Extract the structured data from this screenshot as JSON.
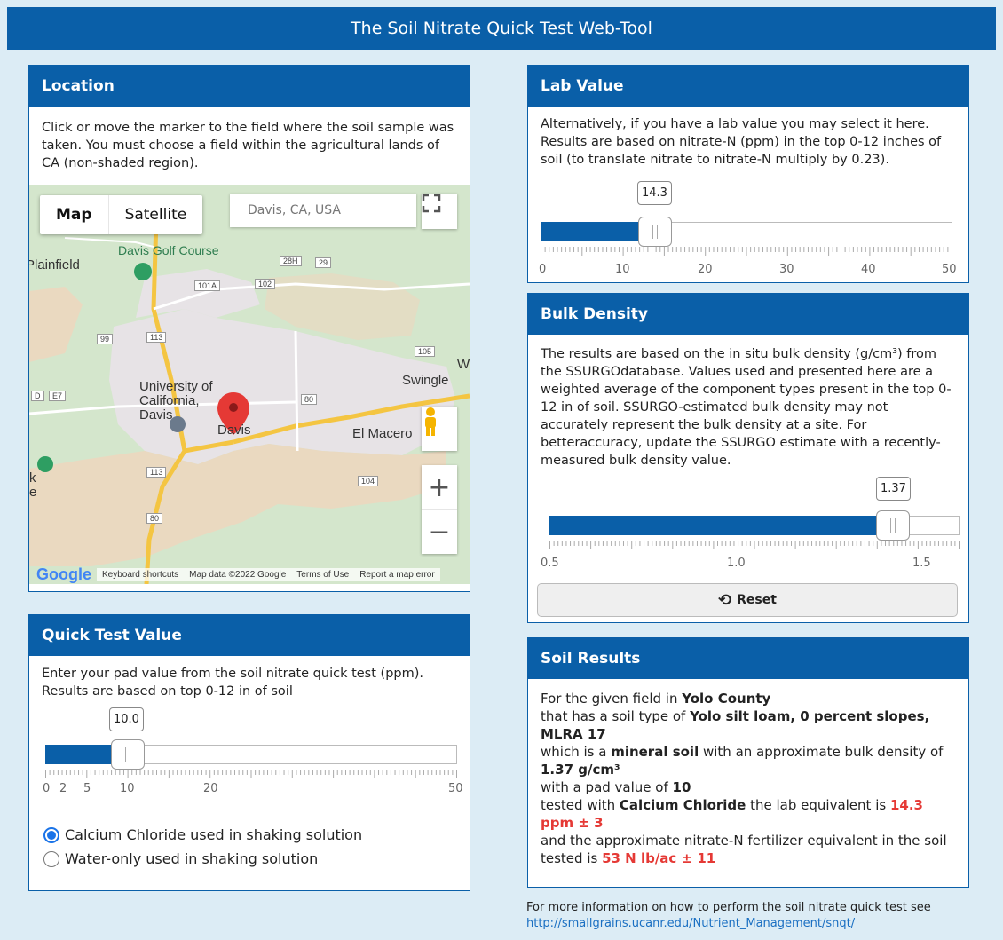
{
  "header": {
    "title": "The Soil Nitrate Quick Test Web-Tool"
  },
  "location": {
    "title": "Location",
    "description": "Click or move the marker to the field where the soil sample was taken. You must choose a field within the agricultural lands of CA (non-shaded region).",
    "map": {
      "toggle": [
        "Map",
        "Satellite"
      ],
      "search_placeholder": "Davis, CA, USA",
      "labels": {
        "golf": "Davis Golf Course",
        "plainfield": "Plainfield",
        "university": "University of\nCalifornia,\nDavis",
        "davis": "Davis",
        "el_macero": "El Macero",
        "swingle": "Swingle",
        "w": "W",
        "k": "k",
        "e": "e"
      },
      "shields": [
        "28H",
        "29",
        "101A",
        "102",
        "99",
        "113",
        "105",
        "E7",
        "D",
        "80",
        "113",
        "104",
        "80"
      ],
      "footer": {
        "logo": "Google",
        "shortcuts": "Keyboard shortcuts",
        "data": "Map data ©2022 Google",
        "terms": "Terms of Use",
        "report": "Report a map error"
      }
    }
  },
  "quick_test": {
    "title": "Quick Test Value",
    "description": "Enter your pad value from the soil nitrate quick test (ppm). Results are based on top 0-12 in of soil",
    "slider": {
      "value": "10.0",
      "min": 0,
      "max": 50,
      "current": 10,
      "tick_labels": [
        "0",
        "2",
        "5",
        "10",
        "20",
        "50"
      ]
    },
    "radios": [
      {
        "label": "Calcium Chloride used in shaking solution",
        "checked": true
      },
      {
        "label": "Water-only used in shaking solution",
        "checked": false
      }
    ]
  },
  "lab_value": {
    "title": "Lab Value",
    "description": "Alternatively, if you have a lab value you may select it here. Results are based on nitrate-N (ppm) in the top 0-12 inches of soil (to translate nitrate to nitrate-N multiply by 0.23).",
    "slider": {
      "value": "14.3",
      "min": 0,
      "max": 50,
      "current": 14.3,
      "tick_labels": [
        "0",
        "10",
        "20",
        "30",
        "40",
        "50"
      ]
    }
  },
  "bulk_density": {
    "title": "Bulk Density",
    "description": "The results are based on the in situ bulk density (g/cm³) from the SSURGOdatabase. Values used and presented here are a weighted average of the component types present in the top 0-12 in of soil. SSURGO-estimated bulk density may not accurately represent the bulk density at a site. For betteraccuracy, update the SSURGO estimate with a recently-measured bulk density value.",
    "slider": {
      "value": "1.37",
      "min": 0.5,
      "max": 1.6,
      "current": 1.37,
      "tick_labels": [
        "0.5",
        "1.0",
        "1.5"
      ]
    },
    "reset_label": "Reset"
  },
  "soil_results": {
    "title": "Soil Results",
    "line1": "For the given field in ",
    "county": "Yolo County",
    "line2": "that has a soil type of ",
    "soil_type": "Yolo silt loam, 0 percent slopes, MLRA 17",
    "line3": "which is a ",
    "soil_class": "mineral soil",
    "line3b": " with an approximate bulk density of ",
    "bulk_density": "1.37 g/cm³",
    "line4": "with a pad value of ",
    "pad_value": "10",
    "line5": "tested with ",
    "solution": "Calcium Chloride",
    "line5b": " the lab equivalent is ",
    "lab_equiv": "14.3 ppm ± 3",
    "line6": "and the approximate nitrate-N fertilizer equivalent in the soil tested is ",
    "fert_equiv": "53 N lb/ac ± 11"
  },
  "more_info": {
    "text": "For more information on how to perform the soil nitrate quick test see",
    "link": "http://smallgrains.ucanr.edu/Nutrient_Management/snqt/"
  }
}
